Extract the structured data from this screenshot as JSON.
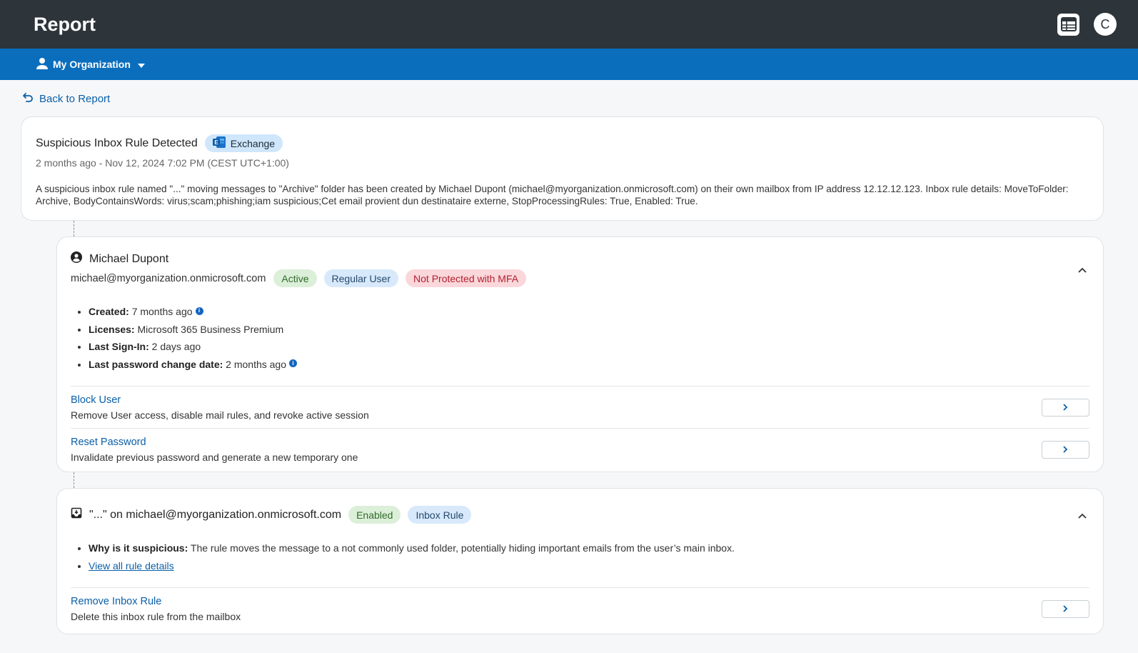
{
  "header": {
    "title": "Report",
    "calendar_icon": "calendar-table-icon",
    "avatar_initial": "C"
  },
  "orgbar": {
    "label": "My Organization",
    "person_icon": "person-icon",
    "caret_icon": "caret-down-icon"
  },
  "back": {
    "label": "Back to Report",
    "icon": "back-arrow-icon"
  },
  "alert": {
    "title": "Suspicious Inbox Rule Detected",
    "source_tag": "Exchange",
    "time": "2 months ago - Nov 12, 2024 7:02 PM (CEST UTC+1:00)",
    "description": "A suspicious inbox rule named \"...\" moving messages to \"Archive\" folder has been created by Michael Dupont (michael@myorganization.onmicrosoft.com) on their own mailbox from IP address 12.12.12.123. Inbox rule details: MoveToFolder: Archive, BodyContainsWords: virus;scam;phishing;iam suspicious;Cet email provient dun destinataire externe, StopProcessingRules: True, Enabled: True."
  },
  "user": {
    "name": "Michael Dupont",
    "email": "michael@myorganization.onmicrosoft.com",
    "tags": {
      "status": "Active",
      "role": "Regular User",
      "mfa": "Not Protected with MFA"
    },
    "facts": [
      {
        "label": "Created:",
        "value": "7 months ago"
      },
      {
        "label": "Licenses:",
        "value": "Microsoft 365 Business Premium"
      },
      {
        "label": "Last Sign-In:",
        "value": "2 days ago"
      },
      {
        "label": "Last password change date:",
        "value": "2 months ago"
      }
    ],
    "actions": [
      {
        "title": "Block User",
        "desc": "Remove User access, disable mail rules, and revoke active session"
      },
      {
        "title": "Reset Password",
        "desc": "Invalidate previous password and generate a new temporary one"
      }
    ]
  },
  "rule": {
    "title": "\"...\" on michael@myorganization.onmicrosoft.com",
    "tags": {
      "state": "Enabled",
      "type": "Inbox Rule"
    },
    "why_label": "Why is it suspicious:",
    "why_value": "The rule moves the message to a not commonly used folder, potentially hiding important emails from the user’s main inbox.",
    "details_link": "View all rule details",
    "actions": [
      {
        "title": "Remove Inbox Rule",
        "desc": "Delete this inbox rule from the mailbox"
      }
    ]
  },
  "colors": {
    "topbar": "#2d353b",
    "orgbar": "#0a6ebd",
    "link": "#0a5fa8"
  }
}
